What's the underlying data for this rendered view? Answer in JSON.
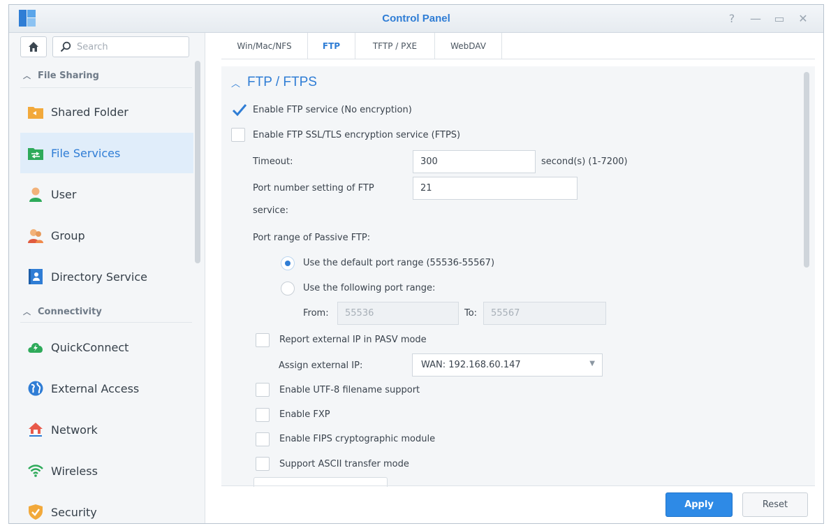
{
  "window": {
    "title": "Control Panel",
    "controls": {
      "help": "?",
      "minimize": "—",
      "maximize": "▭",
      "close": "✕"
    }
  },
  "sidebar": {
    "search_placeholder": "Search",
    "sections": [
      {
        "label": "File Sharing",
        "items": [
          {
            "label": "Shared Folder",
            "icon": "shared-folder-icon"
          },
          {
            "label": "File Services",
            "icon": "file-services-icon",
            "active": true
          },
          {
            "label": "User",
            "icon": "user-icon"
          },
          {
            "label": "Group",
            "icon": "group-icon"
          },
          {
            "label": "Directory Service",
            "icon": "directory-service-icon"
          }
        ]
      },
      {
        "label": "Connectivity",
        "items": [
          {
            "label": "QuickConnect",
            "icon": "quickconnect-icon"
          },
          {
            "label": "External Access",
            "icon": "external-access-icon"
          },
          {
            "label": "Network",
            "icon": "network-icon"
          },
          {
            "label": "Wireless",
            "icon": "wireless-icon"
          },
          {
            "label": "Security",
            "icon": "security-icon"
          }
        ]
      }
    ]
  },
  "tabs": [
    {
      "label": "Win/Mac/NFS"
    },
    {
      "label": "FTP",
      "active": true
    },
    {
      "label": "TFTP / PXE"
    },
    {
      "label": "WebDAV"
    }
  ],
  "ftp": {
    "section_title": "FTP / FTPS",
    "enable_ftp": {
      "label": "Enable FTP service (No encryption)",
      "checked": true
    },
    "enable_ftps": {
      "label": "Enable FTP SSL/TLS encryption service (FTPS)",
      "checked": false
    },
    "timeout": {
      "label": "Timeout:",
      "value": "300",
      "suffix": "second(s) (1-7200)"
    },
    "port": {
      "label_line1": "Port number setting of FTP",
      "label_line2": "service:",
      "value": "21"
    },
    "passive_label": "Port range of Passive FTP:",
    "default_range": {
      "label": "Use the default port range (55536-55567)",
      "selected": true
    },
    "custom_range": {
      "label": "Use the following port range:",
      "selected": false
    },
    "from_label": "From:",
    "from_value": "55536",
    "to_label": "To:",
    "to_value": "55567",
    "report_ip": {
      "label": "Report external IP in PASV mode",
      "checked": false
    },
    "assign_ip": {
      "label": "Assign external IP:",
      "value": "WAN: 192.168.60.147"
    },
    "utf8": {
      "label": "Enable UTF-8 filename support",
      "checked": false
    },
    "fxp": {
      "label": "Enable FXP",
      "checked": false
    },
    "fips": {
      "label": "Enable FIPS cryptographic module",
      "checked": false
    },
    "ascii": {
      "label": "Support ASCII transfer mode",
      "checked": false
    }
  },
  "footer": {
    "apply": "Apply",
    "reset": "Reset"
  },
  "colors": {
    "accent": "#2f7dd5",
    "primary_button": "#2e8ae6",
    "active_nav_bg": "#e0edfa"
  }
}
